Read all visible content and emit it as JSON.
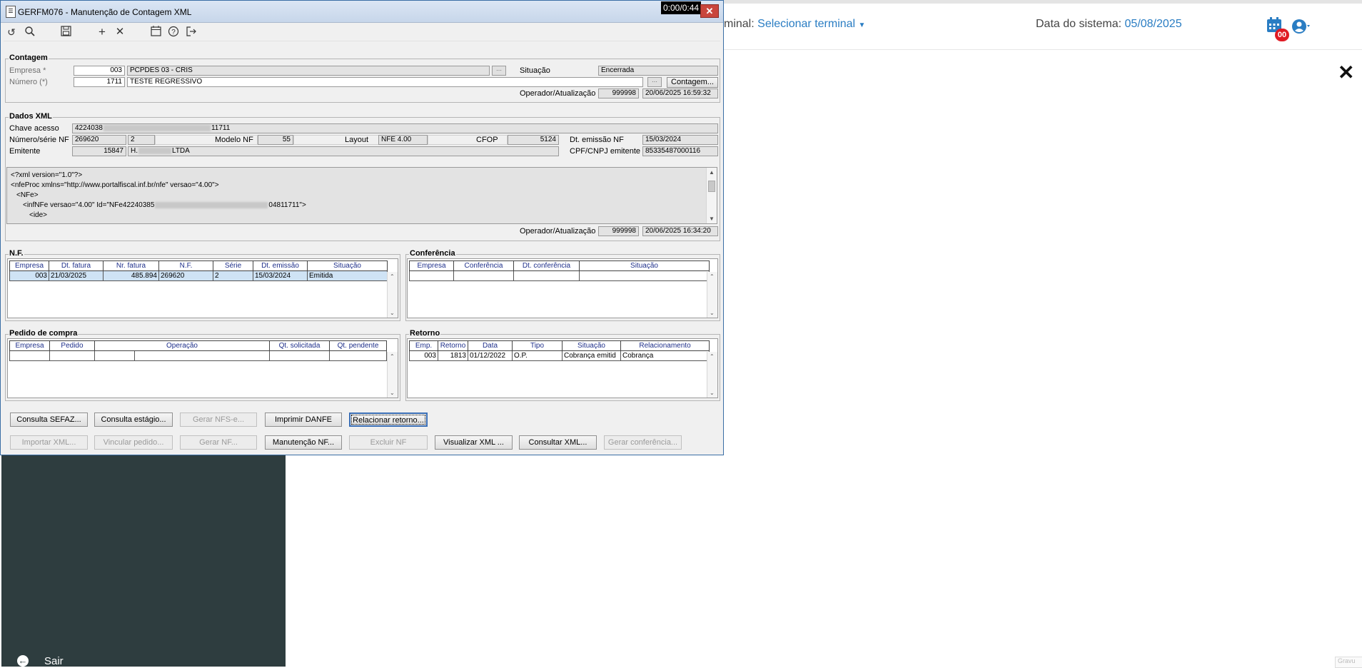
{
  "app": {
    "terminal_label": "minal:",
    "terminal_value": "Selecionar terminal",
    "date_label": "Data do sistema:",
    "date_value": "05/08/2025",
    "badge_count": "00",
    "sair": "Sair",
    "corner_text": "Gravu"
  },
  "window": {
    "title": "GERFM076 - Manutenção de Contagem XML",
    "timer": "0:00/0:44",
    "toolbar_icons": [
      "undo-icon",
      "search-icon",
      "save-icon",
      "add-icon",
      "delete-icon",
      "calendar-icon",
      "help-icon",
      "exit-icon"
    ]
  },
  "contagem": {
    "group": "Contagem",
    "empresa_label": "Empresa *",
    "empresa_code": "003",
    "empresa_name": "PCPDES 03 - CRIS",
    "numero_label": "Número (*)",
    "numero_value": "1711",
    "numero_desc": "TESTE REGRESSIVO",
    "situacao_label": "Situação",
    "situacao_value": "Encerrada",
    "contagem_button": "Contagem...",
    "operador_label": "Operador/Atualização",
    "operador_value": "999998",
    "operador_datetime": "20/06/2025 16:59:32"
  },
  "dados_xml": {
    "group": "Dados XML",
    "chave_label": "Chave acesso",
    "chave_prefix": "4224038",
    "chave_suffix": "11711",
    "numero_serie_label": "Número/série NF",
    "numero_nf": "269620",
    "serie": "2",
    "modelo_label": "Modelo NF",
    "modelo_value": "55",
    "layout_label": "Layout",
    "layout_value": "NFE 4.00",
    "cfop_label": "CFOP",
    "cfop_value": "5124",
    "dt_emissao_label": "Dt. emissão NF",
    "dt_emissao_value": "15/03/2024",
    "emitente_label": "Emitente",
    "emitente_code": "15847",
    "emitente_prefix": "H.",
    "emitente_suffix": "LTDA",
    "cnpj_label": "CPF/CNPJ emitente",
    "cnpj_value": "85335487000116",
    "xml_lines": [
      "<?xml version=\"1.0\"?>",
      "<nfeProc xmlns=\"http://www.portalfiscal.inf.br/nfe\" versao=\"4.00\">",
      "<NFe>",
      "<infNFe versao=\"4.00\" Id=\"NFe42240385",
      "04811711\">",
      "<ide>"
    ],
    "operador_label": "Operador/Atualização",
    "operador_value": "999998",
    "operador_datetime": "20/06/2025 16:34:20"
  },
  "nf": {
    "group": "N.F.",
    "columns": [
      "Empresa",
      "Dt. fatura",
      "Nr. fatura",
      "N.F.",
      "Série",
      "Dt. emissão",
      "Situação"
    ],
    "rows": [
      [
        "003",
        "21/03/2025",
        "485.894",
        "269620",
        "2",
        "15/03/2024",
        "Emitida"
      ]
    ]
  },
  "conferencia": {
    "group": "Conferência",
    "columns": [
      "Empresa",
      "Conferência",
      "Dt. conferência",
      "Situação"
    ]
  },
  "pedido": {
    "group": "Pedido de compra",
    "columns": [
      "Empresa",
      "Pedido",
      "Operação",
      "Qt. solicitada",
      "Qt. pendente"
    ]
  },
  "retorno": {
    "group": "Retorno",
    "columns": [
      "Emp.",
      "Retorno",
      "Data",
      "Tipo",
      "Situação",
      "Relacionamento"
    ],
    "rows": [
      [
        "003",
        "1813",
        "01/12/2022",
        "O.P.",
        "Cobrança emitid",
        "Cobrança"
      ]
    ]
  },
  "buttons": {
    "consulta_sefaz": "Consulta SEFAZ...",
    "consulta_estagio": "Consulta estágio...",
    "gerar_nfse": "Gerar NFS-e...",
    "imprimir_danfe": "Imprimir DANFE",
    "relacionar_retorno": "Relacionar retorno...",
    "importar_xml": "Importar XML...",
    "vincular_pedido": "Vincular pedido...",
    "gerar_nf": "Gerar NF...",
    "manutencao_nf": "Manutenção NF...",
    "excluir_nf": "Excluir NF",
    "visualizar_xml": "Visualizar XML ...",
    "consultar_xml": "Consultar XML...",
    "gerar_conferencia": "Gerar conferência..."
  },
  "colors": {
    "sidebar": "#2e3d3f",
    "link": "#2a7dc3",
    "badge": "#e01b24",
    "grid_header_text": "#1e2f8a",
    "selected_row": "#cfe3f5"
  }
}
